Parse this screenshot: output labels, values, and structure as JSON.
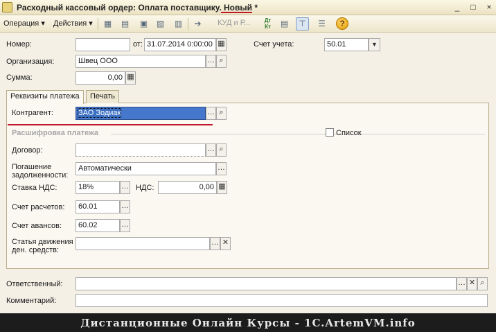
{
  "window": {
    "title": "Расходный кассовый ордер: Оплата поставщику.",
    "status": "Новый *",
    "controls": [
      "_",
      "□",
      "×"
    ]
  },
  "toolbar": {
    "operation_menu": "Операция ▾",
    "actions_menu": "Действия ▾",
    "kud_label": "КУД и Р...",
    "dt_kt_icon": "Дт Кт",
    "help_icon": "?"
  },
  "header": {
    "number_label": "Номер:",
    "number_value": "",
    "date_prefix": "от:",
    "date_value": "31.07.2014  0:00:00",
    "account_label": "Счет учета:",
    "account_value": "50.01",
    "org_label": "Организация:",
    "org_value": "Швец ООО",
    "sum_label": "Сумма:",
    "sum_value": "0,00"
  },
  "tabs": [
    {
      "label": "Реквизиты платежа",
      "active": true
    },
    {
      "label": "Печать",
      "active": false
    }
  ],
  "payment": {
    "counterparty_label": "Контрагент:",
    "counterparty_value": "ЗАО Зодиак",
    "breakdown_title": "Расшифровка платежа",
    "list_label": "Список",
    "list_checked": false,
    "contract_label": "Договор:",
    "contract_value": "",
    "debt_label": "Погашение задолженности:",
    "debt_value": "Автоматически",
    "vat_rate_label": "Ставка НДС:",
    "vat_rate_value": "18%",
    "vat_label": "НДС:",
    "vat_value": "0,00",
    "settlement_label": "Счет расчетов:",
    "settlement_value": "60.01",
    "advance_label": "Счет авансов:",
    "advance_value": "60.02",
    "cashflow_label": "Статья движения ден. средств:",
    "cashflow_value": ""
  },
  "footer": {
    "responsible_label": "Ответственный:",
    "responsible_value": "",
    "comment_label": "Комментарий:",
    "comment_value": ""
  },
  "banner": {
    "text": "Дистанционные Онлайн Курсы - 1C.ArtemVM.info"
  },
  "colors": {
    "accent_red": "#c0182a",
    "selection_blue": "#3b6fc2"
  }
}
